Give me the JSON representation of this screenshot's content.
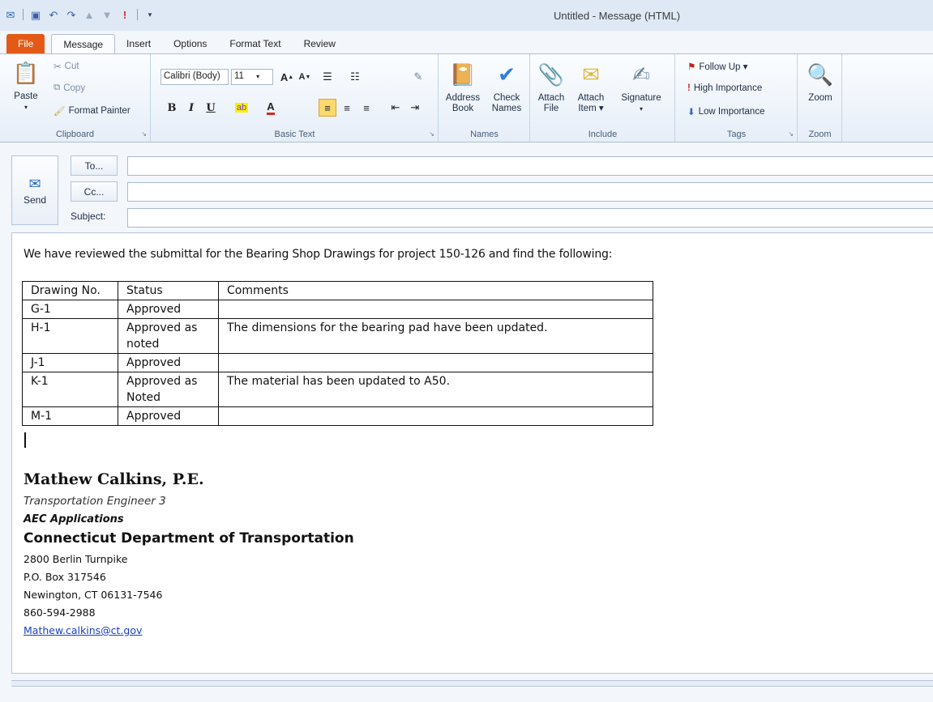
{
  "window": {
    "title": "Untitled  -  Message (HTML)"
  },
  "quick_access": {
    "icons": [
      "outlook-icon",
      "save-icon",
      "undo-icon",
      "redo-icon",
      "up-arrow-icon",
      "down-arrow-icon",
      "importance-icon",
      "customize-icon"
    ]
  },
  "tabs": [
    {
      "label": "File"
    },
    {
      "label": "Message"
    },
    {
      "label": "Insert"
    },
    {
      "label": "Options"
    },
    {
      "label": "Format Text"
    },
    {
      "label": "Review"
    }
  ],
  "ribbon": {
    "clipboard": {
      "label": "Clipboard",
      "paste": "Paste",
      "cut": "Cut",
      "copy": "Copy",
      "format_painter": "Format Painter"
    },
    "basic_text": {
      "label": "Basic Text",
      "font": "Calibri (Body)",
      "size": "11"
    },
    "names": {
      "label": "Names",
      "address_book_1": "Address",
      "address_book_2": "Book",
      "check_names_1": "Check",
      "check_names_2": "Names"
    },
    "include": {
      "label": "Include",
      "attach_file_1": "Attach",
      "attach_file_2": "File",
      "attach_item_1": "Attach",
      "attach_item_2": "Item ▾",
      "signature": "Signature"
    },
    "tags": {
      "label": "Tags",
      "follow_up": "Follow Up ▾",
      "high": "High Importance",
      "low": "Low Importance"
    },
    "zoom": {
      "label": "Zoom",
      "zoom": "Zoom"
    }
  },
  "header": {
    "send": "Send",
    "to": "To...",
    "cc": "Cc...",
    "subject": "Subject:"
  },
  "message": {
    "intro": "We have reviewed the submittal for the Bearing Shop Drawings for project 150-126 and find the following:",
    "table": {
      "headers": [
        "Drawing No.",
        "Status",
        "Comments"
      ],
      "rows": [
        [
          "G-1",
          "Approved",
          ""
        ],
        [
          "H-1",
          "Approved as noted",
          "The dimensions for the bearing pad have been updated."
        ],
        [
          "J-1",
          "Approved",
          ""
        ],
        [
          "K-1",
          "Approved as Noted",
          "The material has been updated to A50."
        ],
        [
          "M-1",
          "Approved",
          ""
        ]
      ]
    },
    "signature": {
      "name": "Mathew Calkins, P.E.",
      "title": "Transportation Engineer 3",
      "unit": "AEC Applications",
      "org": "Connecticut Department of Transportation",
      "address1": "2800 Berlin Turnpike",
      "address2": "P.O. Box 317546",
      "address3": "Newington, CT 06131-7546",
      "phone": "860-594-2988",
      "email": "Mathew.calkins@ct.gov"
    }
  }
}
